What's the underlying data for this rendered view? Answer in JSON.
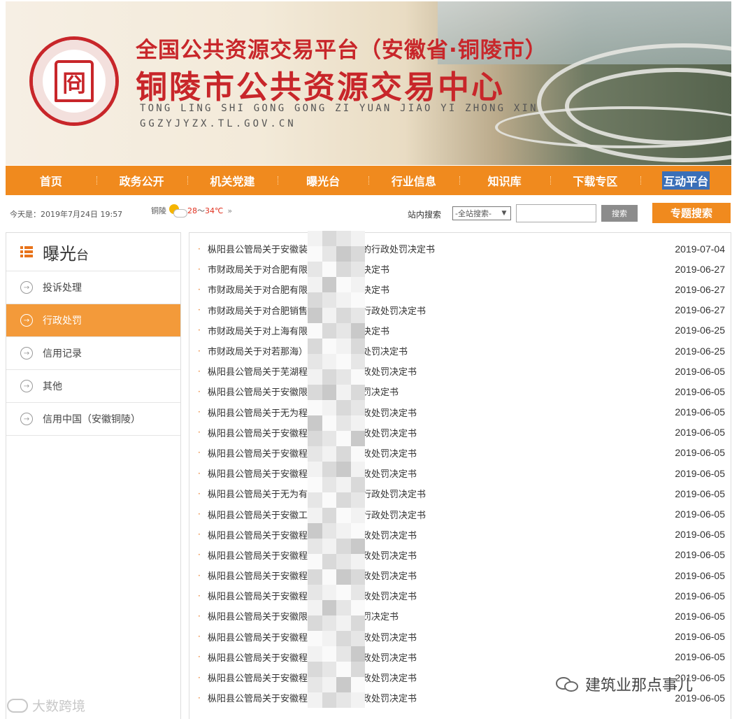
{
  "header": {
    "title_line1": "全国公共资源交易平台（安徽省·铜陵市）",
    "title_line2": "铜陵市公共资源交易中心",
    "pinyin": "TONG LING SHI GONG GONG ZI YUAN JIAO YI ZHONG XIN",
    "domain": "GGZYJYZX.TL.GOV.CN",
    "logo_seal": "冏"
  },
  "nav": {
    "items": [
      {
        "label": "首页"
      },
      {
        "label": "政务公开"
      },
      {
        "label": "机关党建"
      },
      {
        "label": "曝光台"
      },
      {
        "label": "行业信息"
      },
      {
        "label": "知识库"
      },
      {
        "label": "下载专区"
      },
      {
        "label": "互动平台"
      }
    ],
    "selected_index": 7,
    "bg_color": "#f08a1e"
  },
  "infobar": {
    "date_text": "今天是：2019年7月24日  19:57",
    "weather_city": "铜陵",
    "weather_low": "28",
    "weather_sep": "～",
    "weather_high": "34℃",
    "weather_more": "»",
    "search_label": "站内搜索",
    "search_scope": "-全站搜索-",
    "search_button": "搜索",
    "special_search_button": "专题搜索"
  },
  "sidebar": {
    "title_big": "曝光",
    "title_small": "台",
    "items": [
      {
        "label": "投诉处理"
      },
      {
        "label": "行政处罚"
      },
      {
        "label": "信用记录"
      },
      {
        "label": "其他"
      },
      {
        "label": "信用中国（安徽铜陵）"
      }
    ],
    "active_index": 1
  },
  "list": {
    "rows": [
      {
        "title": "枞阳县公管局关于安徽装工程有限公司的行政处罚决定书",
        "date": "2019-07-04"
      },
      {
        "title": "市财政局关于对合肥有限公司行政处罚决定书",
        "date": "2019-06-27"
      },
      {
        "title": "市财政局关于对合肥有限公司行政处罚决定书",
        "date": "2019-06-27"
      },
      {
        "title": "市财政局关于对合肥销售服务有限公司行政处罚决定书",
        "date": "2019-06-27"
      },
      {
        "title": "市财政局关于对上海有限公司行政处罚决定书",
        "date": "2019-06-25"
      },
      {
        "title": "市财政局关于对若那海）有限公司行政处罚决定书",
        "date": "2019-06-25"
      },
      {
        "title": "枞阳县公管局关于芜湖程有限公司的行政处罚决定书",
        "date": "2019-06-05"
      },
      {
        "title": "枞阳县公管局关于安徽限公司的行政处罚决定书",
        "date": "2019-06-05"
      },
      {
        "title": "枞阳县公管局关于无为程有限公司的行政处罚决定书",
        "date": "2019-06-05"
      },
      {
        "title": "枞阳县公管局关于安徽程有限公司的行政处罚决定书",
        "date": "2019-06-05"
      },
      {
        "title": "枞阳县公管局关于安徽程有限公司的行政处罚决定书",
        "date": "2019-06-05"
      },
      {
        "title": "枞阳县公管局关于安徽程有限公司的行政处罚决定书",
        "date": "2019-06-05"
      },
      {
        "title": "枞阳县公管局关于无为有限责任公司的行政处罚决定书",
        "date": "2019-06-05"
      },
      {
        "title": "枞阳县公管局关于安徽工程有限公司的行政处罚决定书",
        "date": "2019-06-05"
      },
      {
        "title": "枞阳县公管局关于安徽程有限公司的行政处罚决定书",
        "date": "2019-06-05"
      },
      {
        "title": "枞阳县公管局关于安徽程有限公司的行政处罚决定书",
        "date": "2019-06-05"
      },
      {
        "title": "枞阳县公管局关于安徽程有限公司的行政处罚决定书",
        "date": "2019-06-05"
      },
      {
        "title": "枞阳县公管局关于安徽程有限公司的行政处罚决定书",
        "date": "2019-06-05"
      },
      {
        "title": "枞阳县公管局关于安徽限公司的行政处罚决定书",
        "date": "2019-06-05"
      },
      {
        "title": "枞阳县公管局关于安徽程有限公司的行政处罚决定书",
        "date": "2019-06-05"
      },
      {
        "title": "枞阳县公管局关于安徽程有限公司的行政处罚决定书",
        "date": "2019-06-05"
      },
      {
        "title": "枞阳县公管局关于安徽程有限公司的行政处罚决定书",
        "date": "2019-06-05"
      },
      {
        "title": "枞阳县公管局关于安徽程有限公司的行政处罚决定书",
        "date": "2019-06-05"
      }
    ]
  },
  "watermarks": {
    "left": "大数跨境",
    "right": "建筑业那点事儿"
  }
}
